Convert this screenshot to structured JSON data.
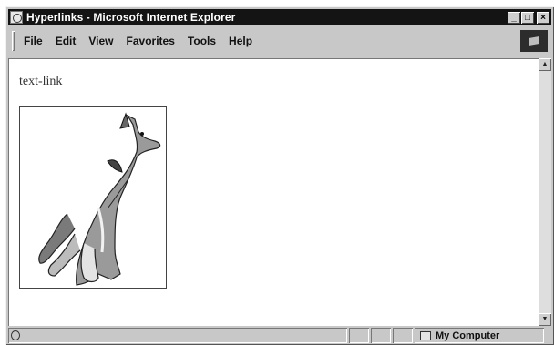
{
  "window": {
    "title": "Hyperlinks - Microsoft Internet Explorer",
    "controls": [
      "_",
      "□",
      "×"
    ]
  },
  "menu": {
    "items": [
      {
        "key": "F",
        "rest": "ile"
      },
      {
        "key": "E",
        "rest": "dit"
      },
      {
        "key": "V",
        "rest": "iew"
      },
      {
        "key": "a",
        "pre": "F",
        "rest": "vorites"
      },
      {
        "key": "T",
        "rest": "ools"
      },
      {
        "key": "H",
        "rest": "elp"
      }
    ]
  },
  "content": {
    "text_link": "text-link",
    "image_link_icon": "wolf-image"
  },
  "scrollbar": {
    "up": "▲",
    "down": "▼"
  },
  "status": {
    "zone": "My Computer"
  },
  "colors": {
    "titlebar": "#141414",
    "chrome": "#c8c8c8",
    "page": "#ffffff"
  }
}
